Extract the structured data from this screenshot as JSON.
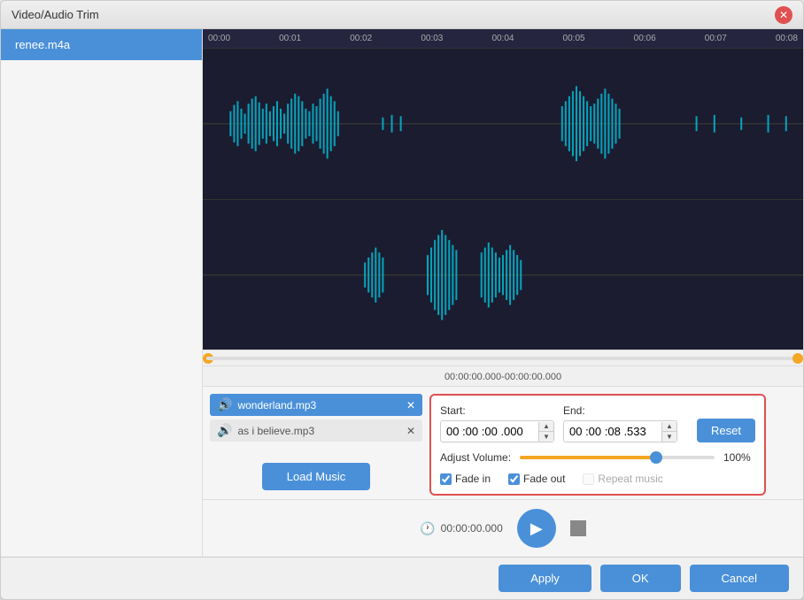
{
  "window": {
    "title": "Video/Audio Trim",
    "close_label": "✕"
  },
  "sidebar": {
    "items": [
      {
        "label": "renee.m4a"
      }
    ]
  },
  "timeline": {
    "labels": [
      "00:00",
      "00:01",
      "00:02",
      "00:03",
      "00:04",
      "00:05",
      "00:06",
      "00:07",
      "00:08"
    ]
  },
  "progress": {
    "time_range": "00:00:00.000-00:00:00.000"
  },
  "music_list": {
    "items": [
      {
        "name": "wonderland.mp3",
        "icon": "🔊"
      },
      {
        "name": "as i believe.mp3",
        "icon": "🔊"
      }
    ]
  },
  "buttons": {
    "load_music": "Load Music",
    "reset": "Reset",
    "apply": "Apply",
    "ok": "OK",
    "cancel": "Cancel"
  },
  "settings": {
    "start_label": "Start:",
    "end_label": "End:",
    "start_value": "00 :00 :00 .000",
    "end_value": "00 :00 :08 .533",
    "adjust_volume_label": "Adjust Volume:",
    "volume_pct": "100%",
    "fade_in_label": "Fade in",
    "fade_out_label": "Fade out",
    "repeat_music_label": "Repeat music",
    "fade_in_checked": true,
    "fade_out_checked": true,
    "repeat_music_checked": false
  },
  "playback": {
    "time": "00:00:00.000"
  }
}
